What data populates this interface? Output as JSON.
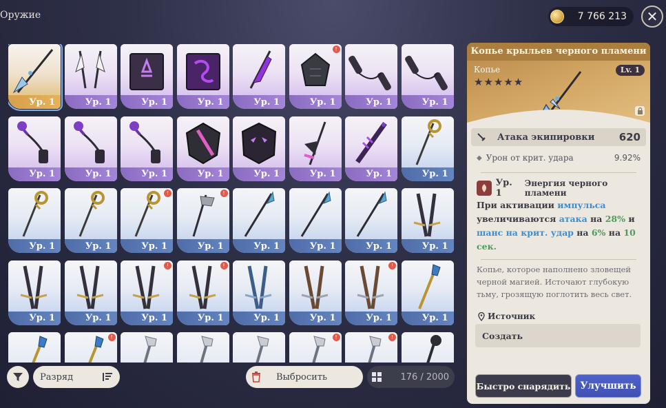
{
  "header": {
    "title": "Оружие",
    "currency_value": "7 766 213",
    "close_icon": "close-icon"
  },
  "grid": {
    "cards": [
      {
        "level": "Ур. 1",
        "rarity": "r5",
        "badge": false,
        "selected": true,
        "art": "spear-dark"
      },
      {
        "level": "Ур. 1",
        "rarity": "r4",
        "badge": false,
        "selected": false,
        "art": "dual-blades-white"
      },
      {
        "level": "Ур. 1",
        "rarity": "r4",
        "badge": false,
        "selected": false,
        "art": "tome-purple"
      },
      {
        "level": "Ур. 1",
        "rarity": "r4",
        "badge": false,
        "selected": false,
        "art": "tome-violet"
      },
      {
        "level": "Ур. 1",
        "rarity": "r4",
        "badge": false,
        "selected": false,
        "art": "blade-purple"
      },
      {
        "level": "Ур. 1",
        "rarity": "r4",
        "badge": true,
        "selected": false,
        "art": "gauntlet-dark"
      },
      {
        "level": "Ур. 1",
        "rarity": "r4",
        "badge": false,
        "selected": false,
        "art": "nunchaku-dark"
      },
      {
        "level": "Ур. 1",
        "rarity": "r4",
        "badge": false,
        "selected": false,
        "art": "nunchaku-dark"
      },
      {
        "level": "Ур. 1",
        "rarity": "r4",
        "badge": false,
        "selected": false,
        "art": "flail-purple"
      },
      {
        "level": "Ур. 1",
        "rarity": "r4",
        "badge": false,
        "selected": false,
        "art": "flail-purple"
      },
      {
        "level": "Ур. 1",
        "rarity": "r4",
        "badge": false,
        "selected": false,
        "art": "flail-purple"
      },
      {
        "level": "Ур. 1",
        "rarity": "r4",
        "badge": false,
        "selected": false,
        "art": "shield-pink"
      },
      {
        "level": "Ур. 1",
        "rarity": "r4",
        "badge": false,
        "selected": false,
        "art": "mask-purple"
      },
      {
        "level": "Ур. 1",
        "rarity": "r4",
        "badge": false,
        "selected": false,
        "art": "scythe-dark"
      },
      {
        "level": "Ур. 1",
        "rarity": "r4",
        "badge": false,
        "selected": false,
        "art": "sword-purple"
      },
      {
        "level": "Ур. 1",
        "rarity": "r3",
        "badge": false,
        "selected": false,
        "art": "staff-gold"
      },
      {
        "level": "Ур. 1",
        "rarity": "r3",
        "badge": false,
        "selected": false,
        "art": "staff-gold"
      },
      {
        "level": "Ур. 1",
        "rarity": "r3",
        "badge": false,
        "selected": false,
        "art": "staff-gold"
      },
      {
        "level": "Ур. 1",
        "rarity": "r3",
        "badge": true,
        "selected": false,
        "art": "staff-gold"
      },
      {
        "level": "Ур. 1",
        "rarity": "r3",
        "badge": true,
        "selected": false,
        "art": "axe-staff"
      },
      {
        "level": "Ур. 1",
        "rarity": "r3",
        "badge": false,
        "selected": false,
        "art": "spear-blue"
      },
      {
        "level": "Ур. 1",
        "rarity": "r3",
        "badge": false,
        "selected": false,
        "art": "spear-blue"
      },
      {
        "level": "Ур. 1",
        "rarity": "r3",
        "badge": false,
        "selected": false,
        "art": "spear-blue"
      },
      {
        "level": "Ур. 1",
        "rarity": "r3",
        "badge": false,
        "selected": false,
        "art": "twin-swords-gold"
      },
      {
        "level": "Ур. 1",
        "rarity": "r3",
        "badge": false,
        "selected": false,
        "art": "twin-swords-gold"
      },
      {
        "level": "Ур. 1",
        "rarity": "r3",
        "badge": false,
        "selected": false,
        "art": "twin-swords-gold"
      },
      {
        "level": "Ур. 1",
        "rarity": "r3",
        "badge": true,
        "selected": false,
        "art": "twin-swords-gold"
      },
      {
        "level": "Ур. 1",
        "rarity": "r3",
        "badge": true,
        "selected": false,
        "art": "twin-swords-gold"
      },
      {
        "level": "Ур. 1",
        "rarity": "r3",
        "badge": false,
        "selected": false,
        "art": "twin-swords-blue"
      },
      {
        "level": "Ур. 1",
        "rarity": "r3",
        "badge": false,
        "selected": false,
        "art": "twin-swords-brown"
      },
      {
        "level": "Ур. 1",
        "rarity": "r3",
        "badge": true,
        "selected": false,
        "art": "twin-swords-brown"
      },
      {
        "level": "Ур. 1",
        "rarity": "r3",
        "badge": false,
        "selected": false,
        "art": "scepter-gold"
      },
      {
        "level": "",
        "rarity": "r3",
        "badge": false,
        "selected": false,
        "art": "scepter-gold"
      },
      {
        "level": "",
        "rarity": "r3",
        "badge": true,
        "selected": false,
        "art": "scepter-gold"
      },
      {
        "level": "",
        "rarity": "r3",
        "badge": false,
        "selected": false,
        "art": "wand-silver"
      },
      {
        "level": "",
        "rarity": "r3",
        "badge": false,
        "selected": false,
        "art": "wand-silver"
      },
      {
        "level": "",
        "rarity": "r3",
        "badge": false,
        "selected": false,
        "art": "wand-silver"
      },
      {
        "level": "",
        "rarity": "r3",
        "badge": true,
        "selected": false,
        "art": "wand-silver"
      },
      {
        "level": "",
        "rarity": "r3",
        "badge": true,
        "selected": false,
        "art": "wand-silver"
      },
      {
        "level": "",
        "rarity": "r3",
        "badge": false,
        "selected": false,
        "art": "mace-dark"
      }
    ]
  },
  "toolbar": {
    "sort_label": "Разряд",
    "discard_label": "Выбросить",
    "capacity": "176 / 2000"
  },
  "detail": {
    "name": "Копье крыльев черного пламени",
    "type": "Копье",
    "level_badge": "Lv. 1",
    "stars": "★★★★★",
    "main_stat": {
      "label": "Атака экипировки",
      "value": "620"
    },
    "sub_stat": {
      "label": "Урон от крит. удара",
      "value": "9.92%"
    },
    "passive": {
      "level": "Ур. 1",
      "name": "Энергия черного пламени",
      "desc_1": "При активации ",
      "desc_2": "импульса",
      "desc_3": " увеличиваются ",
      "desc_4": "атака",
      "desc_5": " на ",
      "desc_6": "28%",
      "desc_7": " и ",
      "desc_8": "шанс на крит. удар",
      "desc_9": " на ",
      "desc_10": "6%",
      "desc_11": " на ",
      "desc_12": "10 сек."
    },
    "lore": "Копье, которое наполнено зловещей черной магией. Источают глубокую тьму, грозящую поглотить весь свет.",
    "source_label": "Источник",
    "source_value": "Создать",
    "quick_equip_label": "Быстро снарядить",
    "upgrade_label": "Улучшить"
  }
}
